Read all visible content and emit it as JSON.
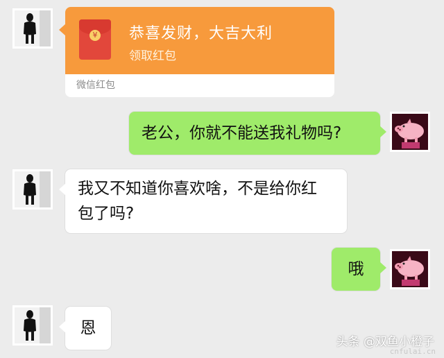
{
  "messages": {
    "red_packet": {
      "title": "恭喜发财，大吉大利",
      "action": "领取红包",
      "footer": "微信红包",
      "seal": "¥"
    },
    "m1": "老公，你就不能送我礼物吗?",
    "m2_line1": "我又不知道你喜欢啥，不是给你红",
    "m2_line2": "包了吗?",
    "m3": "哦",
    "m4": "恩"
  },
  "watermark": {
    "text": "头条 @双鱼小橙子",
    "url": "cnfulai.cn"
  },
  "colors": {
    "background": "#ececec",
    "self_bubble": "#9feb6a",
    "other_bubble": "#ffffff",
    "red_packet": "#f79a3c"
  },
  "icons": [
    "woman-photo-avatar",
    "pink-pig-avatar",
    "red-envelope-icon"
  ]
}
